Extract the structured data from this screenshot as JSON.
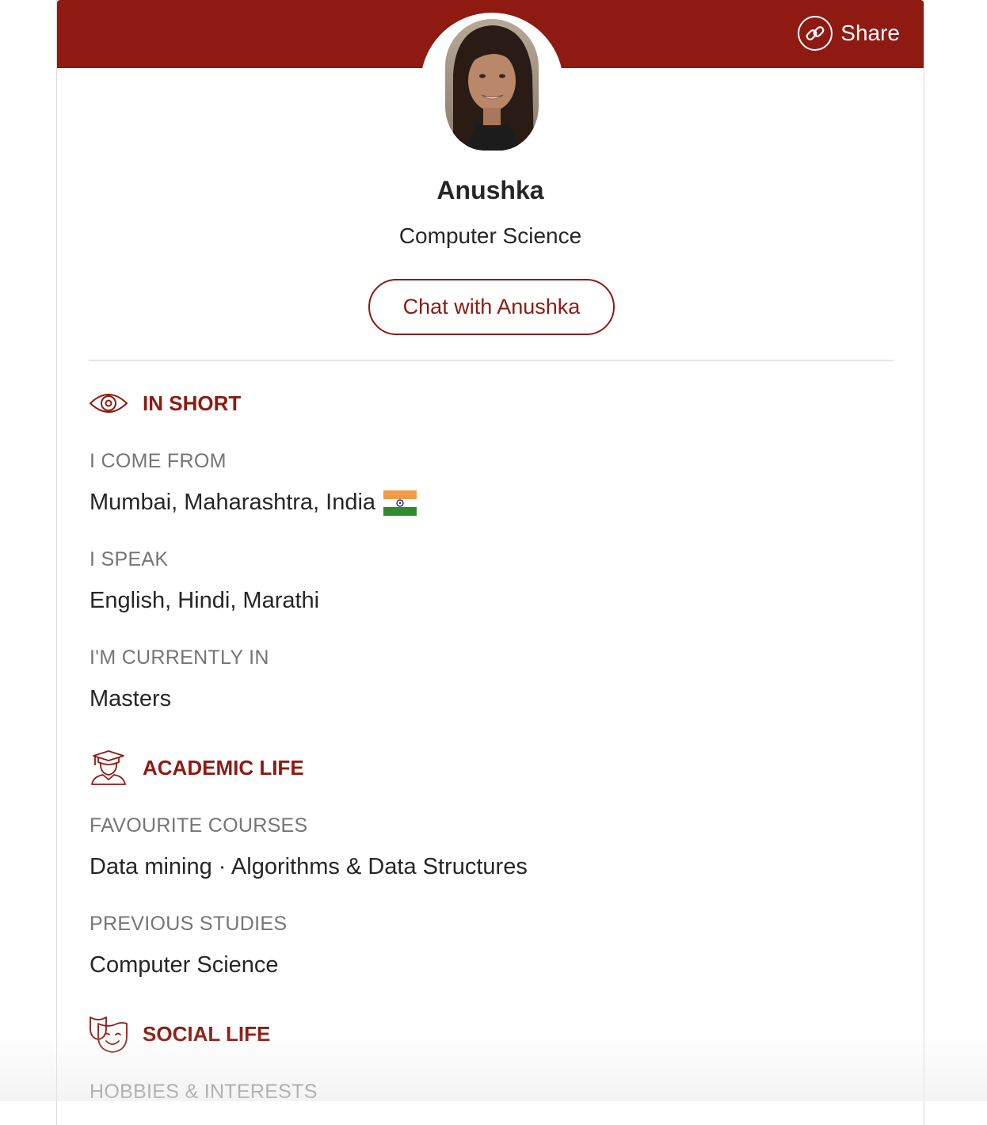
{
  "header": {
    "share_label": "Share",
    "banner_color": "#8e1a12"
  },
  "profile": {
    "name": "Anushka",
    "subject": "Computer Science",
    "chat_label": "Chat with Anushka"
  },
  "sections": {
    "in_short": {
      "title": "IN SHORT",
      "icon": "eye-icon",
      "come_from_label": "I COME FROM",
      "come_from_value": "Mumbai, Maharashtra, India",
      "flag_icon": "india-flag-icon",
      "speak_label": "I SPEAK",
      "speak_value": "English, Hindi, Marathi",
      "currently_label": "I'M CURRENTLY IN",
      "currently_value": "Masters"
    },
    "academic_life": {
      "title": "ACADEMIC LIFE",
      "icon": "graduate-icon",
      "courses_label": "FAVOURITE COURSES",
      "courses_value": "Data mining · Algorithms & Data Structures",
      "previous_label": "PREVIOUS STUDIES",
      "previous_value": "Computer Science"
    },
    "social_life": {
      "title": "SOCIAL LIFE",
      "icon": "theater-masks-icon",
      "hobbies_label": "HOBBIES & INTERESTS"
    }
  },
  "colors": {
    "accent": "#8e1a12",
    "label": "#757575",
    "text": "#262626"
  }
}
